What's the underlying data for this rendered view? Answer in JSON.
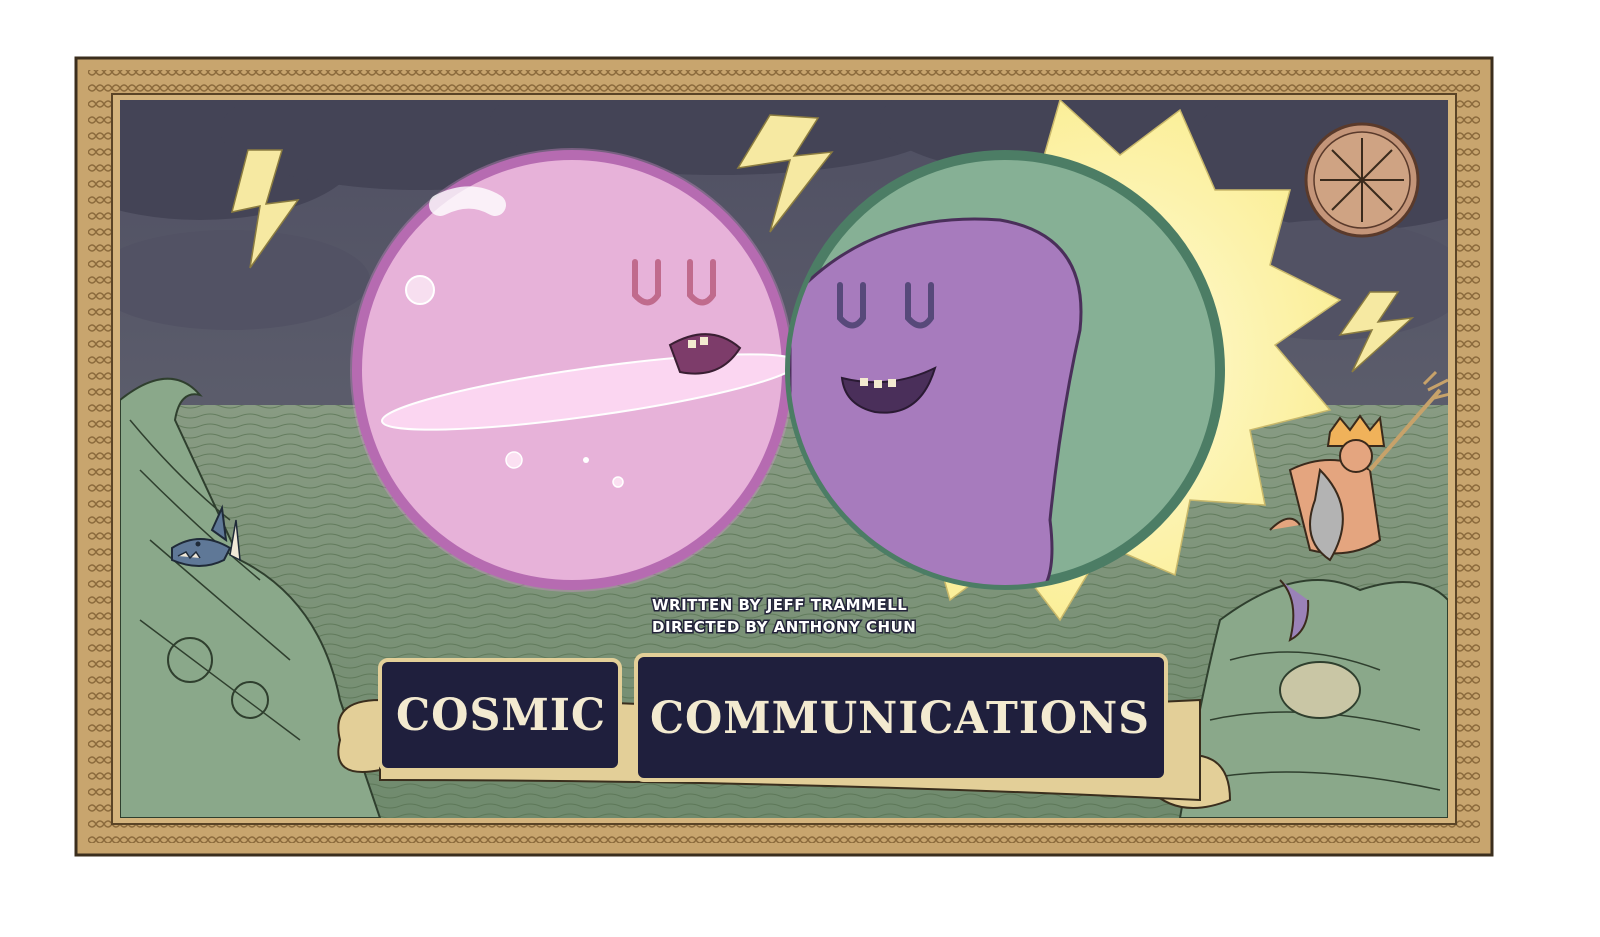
{
  "credits": {
    "written_by": "WRITTEN BY JEFF TRAMMELL",
    "directed_by": "DIRECTED BY ANTHONY CHUN"
  },
  "title": {
    "word1": "COSMIC",
    "word2": "COMMUNICATIONS"
  },
  "colors": {
    "frame": "#c8a56e",
    "sky": "#5a5a6e",
    "sea": "#7d9479",
    "pink_ball": "#e7b2d9",
    "purple_ball": "#a77bbd",
    "green_ball": "#86b095",
    "sun": "#fbef9a",
    "banner": "#e3cf98",
    "title_panel": "#1f1f3d"
  },
  "icons": [
    "compass-rose-icon",
    "lightning-bolt-icon",
    "shark-icon",
    "king-neptune-icon",
    "wave-icon"
  ]
}
